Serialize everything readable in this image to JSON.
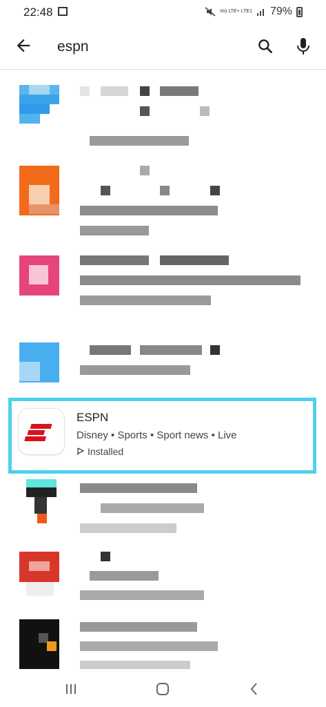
{
  "status_bar": {
    "time": "22:48",
    "network": "Vo) LTE+ LTE1",
    "battery": "79%"
  },
  "search": {
    "query": "espn"
  },
  "highlighted_app": {
    "title": "ESPN",
    "developer": "Disney",
    "categories": [
      "Sports",
      "Sport news",
      "Live"
    ],
    "meta_line": "Disney • Sports • Sport news • Live",
    "status": "Installed",
    "brand_color": "#d8121b",
    "highlight_color": "#4fd0ee"
  },
  "icons": {
    "back": "arrow-left-icon",
    "search": "search-icon",
    "mic": "microphone-icon",
    "nav_recents": "recents-icon",
    "nav_home": "home-icon",
    "nav_back": "chevron-left-icon"
  }
}
